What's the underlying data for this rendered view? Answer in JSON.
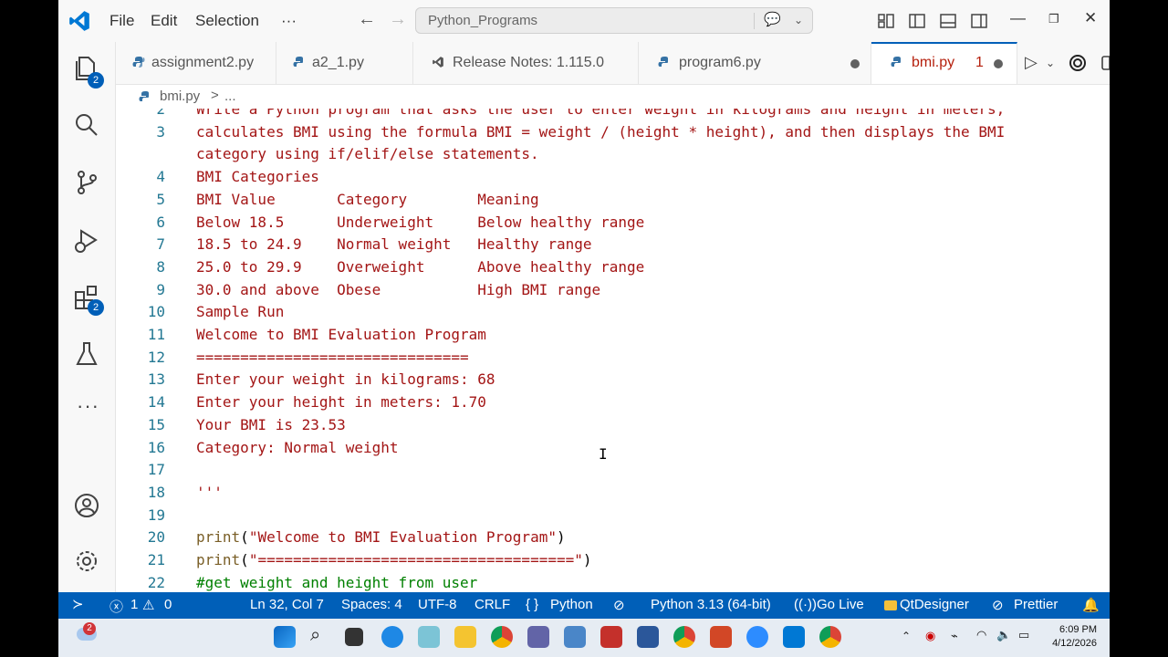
{
  "menu": {
    "file": "File",
    "edit": "Edit",
    "selection": "Selection",
    "more": "···"
  },
  "search": {
    "text": "Python_Programs"
  },
  "tabs": [
    {
      "label": "assignment2.py",
      "icon": "python-icon"
    },
    {
      "label": "a2_1.py",
      "icon": "python-icon"
    },
    {
      "label": "Release Notes: 1.115.0",
      "icon": "vscode-icon"
    },
    {
      "label": "program6.py",
      "icon": "python-icon",
      "modified": true
    },
    {
      "label": "bmi.py",
      "icon": "python-icon",
      "problems": "1",
      "modified": true,
      "active": true
    }
  ],
  "breadcrumb": {
    "file": "bmi.py",
    "separator": ">",
    "rest": "..."
  },
  "activity_badges": {
    "explorer": "2",
    "extensions": "2"
  },
  "code_lines": [
    {
      "n": "2",
      "segs": [
        [
          "s",
          "Write a Python program that asks the user to enter weight in kilograms and height in meters,"
        ]
      ]
    },
    {
      "n": "3",
      "segs": [
        [
          "s",
          "calculates BMI using the formula BMI = weight / (height * height), and then displays the BMI"
        ]
      ]
    },
    {
      "n": "",
      "segs": [
        [
          "s",
          "category using if/elif/else statements."
        ]
      ]
    },
    {
      "n": "4",
      "segs": [
        [
          "s",
          "BMI Categories"
        ]
      ]
    },
    {
      "n": "5",
      "segs": [
        [
          "s",
          "BMI Value       Category        Meaning"
        ]
      ]
    },
    {
      "n": "6",
      "segs": [
        [
          "s",
          "Below 18.5      Underweight     Below healthy range"
        ]
      ]
    },
    {
      "n": "7",
      "segs": [
        [
          "s",
          "18.5 to 24.9    Normal weight   Healthy range"
        ]
      ]
    },
    {
      "n": "8",
      "segs": [
        [
          "s",
          "25.0 to 29.9    Overweight      Above healthy range"
        ]
      ]
    },
    {
      "n": "9",
      "segs": [
        [
          "s",
          "30.0 and above  Obese           High BMI range"
        ]
      ]
    },
    {
      "n": "10",
      "segs": [
        [
          "s",
          "Sample Run"
        ]
      ]
    },
    {
      "n": "11",
      "segs": [
        [
          "s",
          "Welcome to BMI Evaluation Program"
        ]
      ]
    },
    {
      "n": "12",
      "segs": [
        [
          "s",
          "==============================="
        ]
      ]
    },
    {
      "n": "13",
      "segs": [
        [
          "s",
          "Enter your weight in kilograms: 68"
        ]
      ]
    },
    {
      "n": "14",
      "segs": [
        [
          "s",
          "Enter your height in meters: 1.70"
        ]
      ]
    },
    {
      "n": "15",
      "segs": [
        [
          "s",
          "Your BMI is 23.53"
        ]
      ]
    },
    {
      "n": "16",
      "segs": [
        [
          "s",
          "Category: Normal weight"
        ]
      ]
    },
    {
      "n": "17",
      "segs": []
    },
    {
      "n": "18",
      "segs": [
        [
          "s",
          "'''"
        ]
      ]
    },
    {
      "n": "19",
      "segs": []
    },
    {
      "n": "20",
      "segs": [
        [
          "fn",
          "print"
        ],
        [
          "p",
          "("
        ],
        [
          "s",
          "\"Welcome to BMI Evaluation Program\""
        ],
        [
          "p",
          ")"
        ]
      ]
    },
    {
      "n": "21",
      "segs": [
        [
          "fn",
          "print"
        ],
        [
          "p",
          "("
        ],
        [
          "s",
          "\"====================================\""
        ],
        [
          "p",
          ")"
        ]
      ]
    },
    {
      "n": "22",
      "segs": [
        [
          "cm",
          "#get weight and height from user"
        ]
      ]
    }
  ],
  "status": {
    "errors": "1",
    "warnings": "0",
    "position": "Ln 32, Col 7",
    "spaces": "Spaces: 4",
    "encoding": "UTF-8",
    "eol": "CRLF",
    "language": "Python",
    "interpreter": "Python 3.13 (64-bit)",
    "golive": "Go Live",
    "qtdesigner": "QtDesigner",
    "prettier": "Prettier"
  },
  "taskbar": {
    "time": "6:09 PM",
    "date": "4/12/2026",
    "weather_badge": "2"
  },
  "colors": {
    "accent": "#005fb8",
    "string": "#a31515",
    "function": "#795e26",
    "comment": "#008000",
    "line_number": "#237893"
  }
}
